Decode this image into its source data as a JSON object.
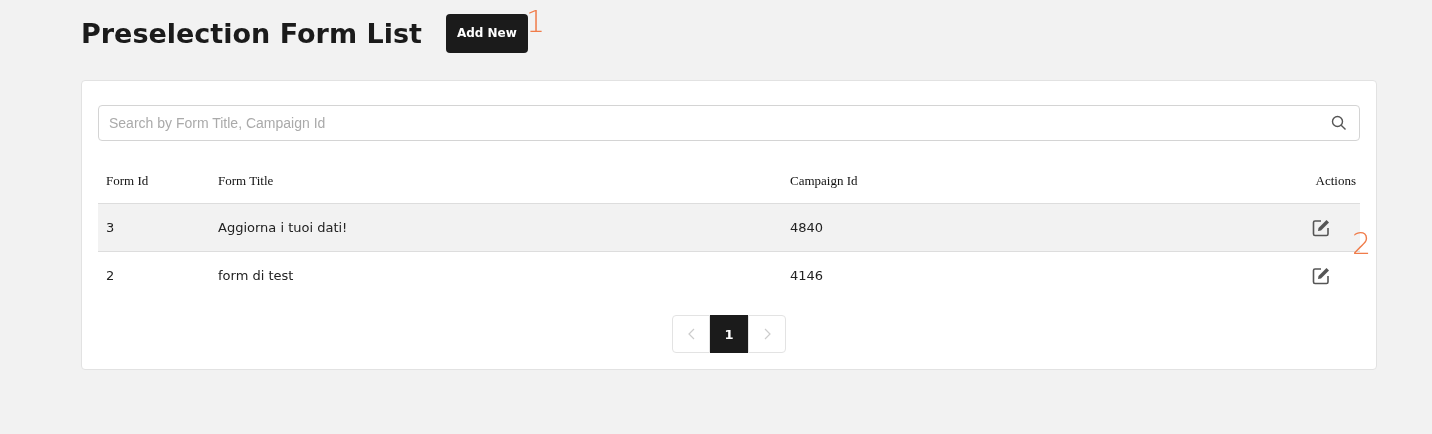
{
  "page": {
    "title": "Preselection Form List",
    "add_button": "Add New"
  },
  "search": {
    "placeholder": "Search by Form Title, Campaign Id"
  },
  "table": {
    "columns": [
      "Form Id",
      "Form Title",
      "Campaign Id",
      "Actions"
    ],
    "rows": [
      {
        "form_id": "3",
        "form_title": "Aggiorna i tuoi dati!",
        "campaign_id": "4840",
        "selected": true
      },
      {
        "form_id": "2",
        "form_title": "form di test",
        "campaign_id": "4146",
        "selected": false
      }
    ]
  },
  "pagination": {
    "pages": [
      {
        "label": "1",
        "selected": true
      }
    ]
  },
  "annotations": [
    {
      "label": "1"
    },
    {
      "label": "2"
    }
  ]
}
